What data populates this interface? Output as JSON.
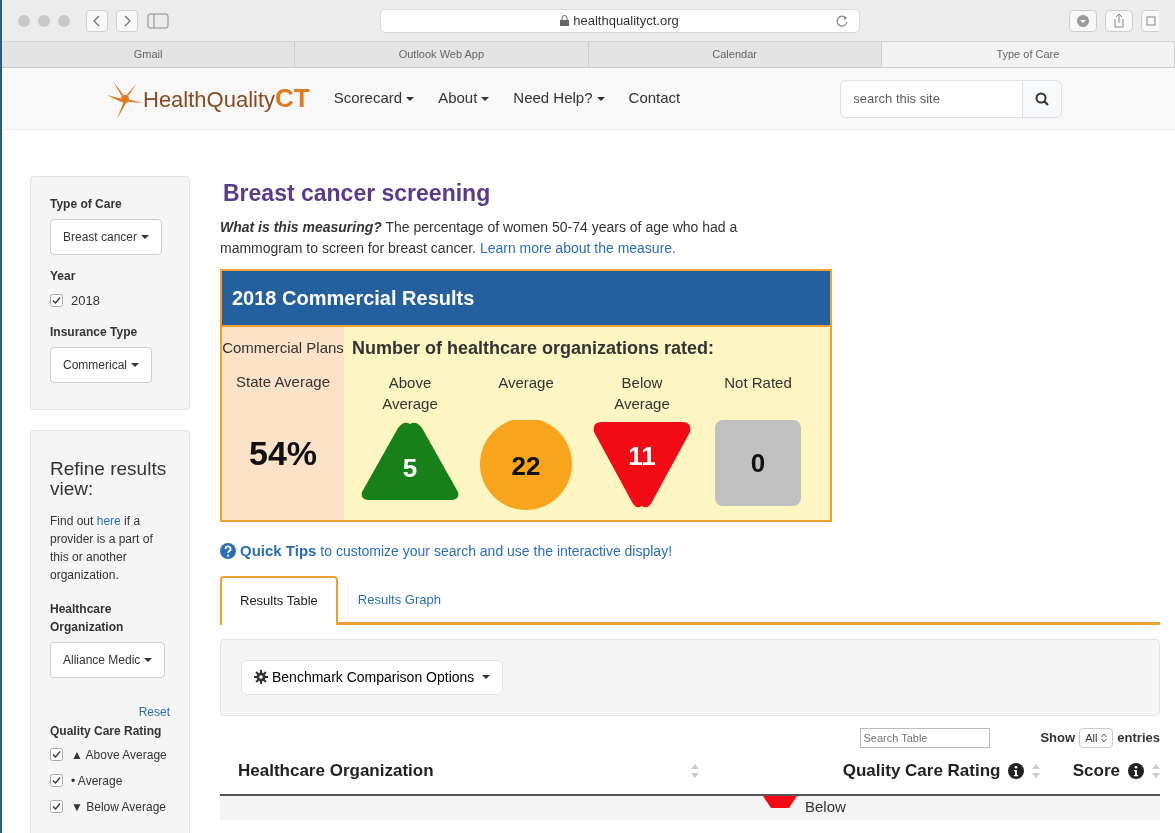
{
  "browser": {
    "address": "healthqualityct.org",
    "bookmarks": [
      {
        "label": "Gmail",
        "selected": false
      },
      {
        "label": "Outlook Web App",
        "selected": false
      },
      {
        "label": "Calendar",
        "selected": false
      },
      {
        "label": "Type of Care",
        "selected": true
      }
    ]
  },
  "site_header": {
    "logo": {
      "main": "HealthQuality",
      "accent": "CT"
    },
    "nav": [
      {
        "label": "Scorecard",
        "dropdown": true
      },
      {
        "label": "About",
        "dropdown": true
      },
      {
        "label": "Need Help?",
        "dropdown": true
      },
      {
        "label": "Contact",
        "dropdown": false
      }
    ],
    "search": {
      "placeholder": "search this site"
    }
  },
  "filters": [
    {
      "kind": "select",
      "label": "Type of Care",
      "value": "Breast cancer"
    },
    {
      "kind": "checkbox",
      "label": "Year",
      "option": "2018",
      "checked": true
    },
    {
      "kind": "select",
      "label": "Insurance Type",
      "value": "Commerical"
    }
  ],
  "refine": {
    "title": "Refine results view:",
    "text_before": "Find out ",
    "link": "here",
    "text_after": " if a provider is a part of this or another organization.",
    "org_label": "Healthcare Organization",
    "org_value": "Alliance Medic",
    "reset": "Reset",
    "rating_label": "Quality Care Rating",
    "ratings": [
      {
        "symbol": "▲",
        "label": "Above Average",
        "checked": true
      },
      {
        "symbol": "•",
        "label": "Average",
        "checked": true
      },
      {
        "symbol": "▼",
        "label": "Below Average",
        "checked": true
      }
    ]
  },
  "measure": {
    "title": "Breast cancer screening",
    "lead": "What is this measuring?",
    "text": " The percentage of women 50-74 years of age who had a mammogram to screen for breast cancer. ",
    "link": "Learn more about the measure."
  },
  "results": {
    "title": "2018 Commercial Results",
    "plans": "Commercial Plans",
    "average_label": "State Average",
    "average": "54%",
    "heading": "Number of healthcare organizations rated:",
    "counts": [
      {
        "kind": "triangle-up",
        "label": "Above Average",
        "count": "5",
        "color": "#188018"
      },
      {
        "kind": "circle",
        "label": "Average",
        "count": "22",
        "color": "#f8a51c"
      },
      {
        "kind": "triangle-down",
        "label": "Below Average",
        "count": "11",
        "color": "#f20a14"
      },
      {
        "kind": "square",
        "label": "Not Rated",
        "count": "0",
        "color": "#c0c0c0"
      }
    ]
  },
  "quick_tips": {
    "title": "Quick Tips",
    "text": " to customize your search and use the interactive display!"
  },
  "tabs": [
    {
      "label": "Results Table",
      "selected": true
    },
    {
      "label": "Results Graph",
      "selected": false
    }
  ],
  "benchmark_button": "Benchmark Comparison Options",
  "table": {
    "search_placeholder": "Search Table",
    "show": "Show",
    "entries_value": "All",
    "entries": "entries",
    "columns": [
      {
        "label": "Healthcare Organization",
        "info": false
      },
      {
        "label": "Quality Care Rating",
        "info": true
      },
      {
        "label": "Score",
        "info": true
      }
    ],
    "rows": [
      {
        "rating": "Below"
      }
    ]
  }
}
